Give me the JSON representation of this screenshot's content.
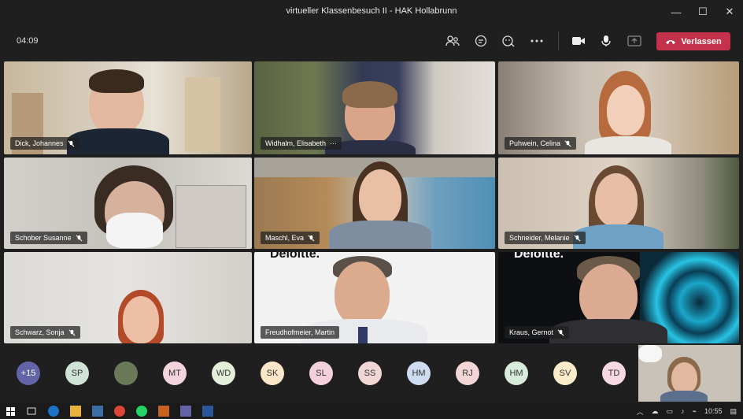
{
  "window": {
    "title": "virtueller Klassenbesuch II - HAK Hollabrunn",
    "minimize": "—",
    "maximize": "☐",
    "close": "✕"
  },
  "toolbar": {
    "timer": "04:09",
    "leave_label": "Verlassen",
    "icons": [
      "participants-icon",
      "chat-icon",
      "reactions-icon",
      "more-icon",
      "camera-icon",
      "mic-icon",
      "share-icon"
    ]
  },
  "participants": [
    {
      "name": "Dick, Johannes",
      "muted": true
    },
    {
      "name": "Widhalm, Elisabeth",
      "more": "···"
    },
    {
      "name": "Puhwein, Celina",
      "muted": true
    },
    {
      "name": "Schober Susanne",
      "muted": true
    },
    {
      "name": "Maschl, Eva",
      "muted": true
    },
    {
      "name": "Schneider, Melanie",
      "muted": true
    },
    {
      "name": "Schwarz, Sonja",
      "muted": true
    },
    {
      "name": "Freudhofmeier, Martin",
      "muted": false
    },
    {
      "name": "Kraus, Gernot",
      "muted": true
    }
  ],
  "brand_text": "Deloitte.",
  "overflow": {
    "count": "+15",
    "avatars": [
      "SP",
      "",
      "MT",
      "WD",
      "SK",
      "SL",
      "SS",
      "HM",
      "RJ",
      "HM",
      "SV",
      "TD"
    ]
  },
  "taskbar": {
    "time": "10:55",
    "start_icon": "windows-icon"
  },
  "colors": {
    "leave": "#c4314b",
    "overflow_badge": "#6264a7"
  }
}
